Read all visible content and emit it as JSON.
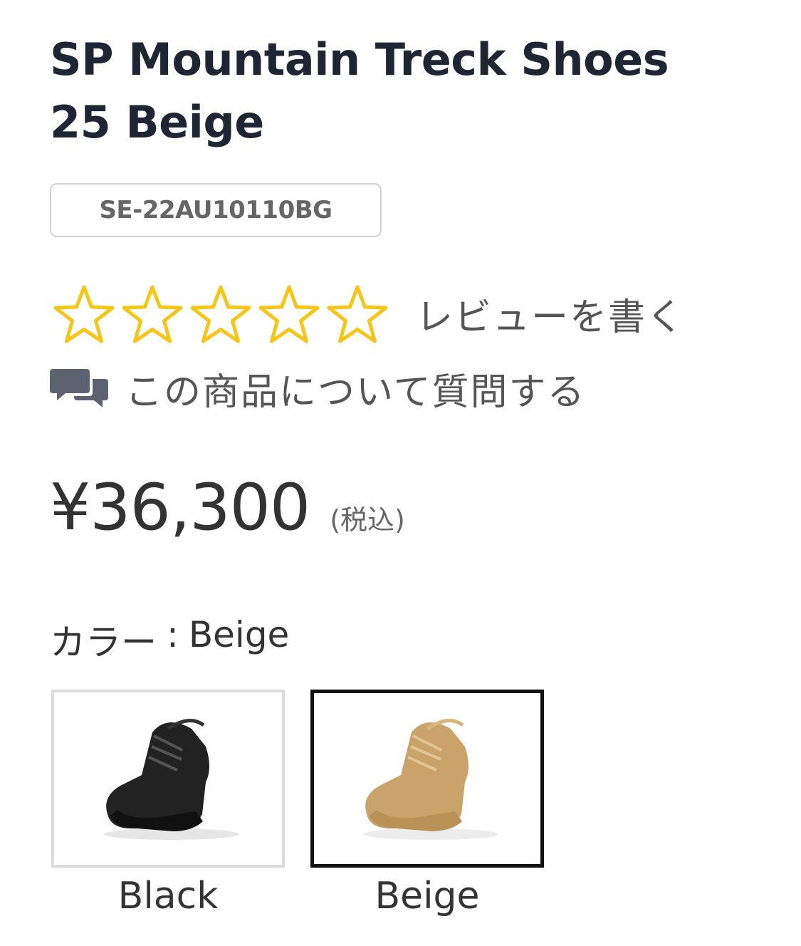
{
  "product": {
    "title_line1": "SP Mountain Treck Shoes",
    "title_line2": "25 Beige",
    "sku": "SE-22AU10110BG"
  },
  "rating": {
    "stars_filled": 0,
    "stars_total": 5,
    "review_link": "レビューを書く",
    "star_color": "#f5c518"
  },
  "question": {
    "label": "この商品について質問する",
    "icon": "chat-bubbles-icon"
  },
  "price": {
    "amount": "¥36,300",
    "tax_note": "(税込)"
  },
  "color": {
    "label": "カラー",
    "separator": ":",
    "selected": "Beige",
    "options": [
      {
        "label": "Black",
        "selected": false,
        "icon": "black-boot-image"
      },
      {
        "label": "Beige",
        "selected": true,
        "icon": "beige-boot-image"
      }
    ]
  }
}
